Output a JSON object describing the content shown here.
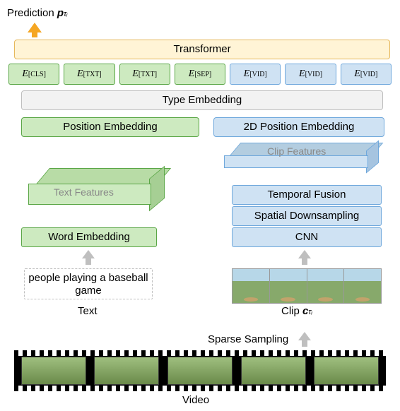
{
  "prediction_label_prefix": "Prediction ",
  "prediction_symbol": "p",
  "prediction_subscript": "τᵢ",
  "transformer_label": "Transformer",
  "tokens": [
    {
      "sym": "E",
      "sub": "[CLS]",
      "cls": "green"
    },
    {
      "sym": "E",
      "sub": "[TXT]",
      "cls": "green"
    },
    {
      "sym": "E",
      "sub": "[TXT]",
      "cls": "green"
    },
    {
      "sym": "E",
      "sub": "[SEP]",
      "cls": "green"
    },
    {
      "sym": "E",
      "sub": "[VID]",
      "cls": "blue"
    },
    {
      "sym": "E",
      "sub": "[VID]",
      "cls": "blue"
    },
    {
      "sym": "E",
      "sub": "[VID]",
      "cls": "blue"
    }
  ],
  "type_embedding_label": "Type Embedding",
  "position_embedding_label": "Position Embedding",
  "position2d_embedding_label": "2D Position Embedding",
  "clip_features_label": "Clip Features",
  "text_features_label": "Text Features",
  "temporal_fusion_label": "Temporal Fusion",
  "spatial_downsampling_label": "Spatial Downsampling",
  "cnn_label": "CNN",
  "word_embedding_label": "Word Embedding",
  "text_input": "people playing a baseball game",
  "text_label": "Text",
  "clip_label_prefix": "Clip ",
  "clip_symbol": "c",
  "clip_subscript": "τᵢ",
  "sparse_sampling_label": "Sparse Sampling",
  "video_label": "Video",
  "chart_data": {
    "type": "diagram",
    "description": "Video-text transformer pipeline",
    "video_pipeline": [
      "Video",
      "Sparse Sampling",
      "Clip c_{τ_i}",
      "CNN",
      "Spatial Downsampling",
      "Temporal Fusion",
      "Clip Features",
      "2D Position Embedding",
      "Type Embedding",
      "E_[VID] tokens",
      "Transformer"
    ],
    "text_pipeline": [
      "Text: people playing a baseball game",
      "Word Embedding",
      "Text Features",
      "Position Embedding",
      "Type Embedding",
      "E_[CLS] E_[TXT] E_[TXT] E_[SEP] tokens",
      "Transformer"
    ],
    "output": "Prediction p_{τ_i} from [CLS] position"
  }
}
